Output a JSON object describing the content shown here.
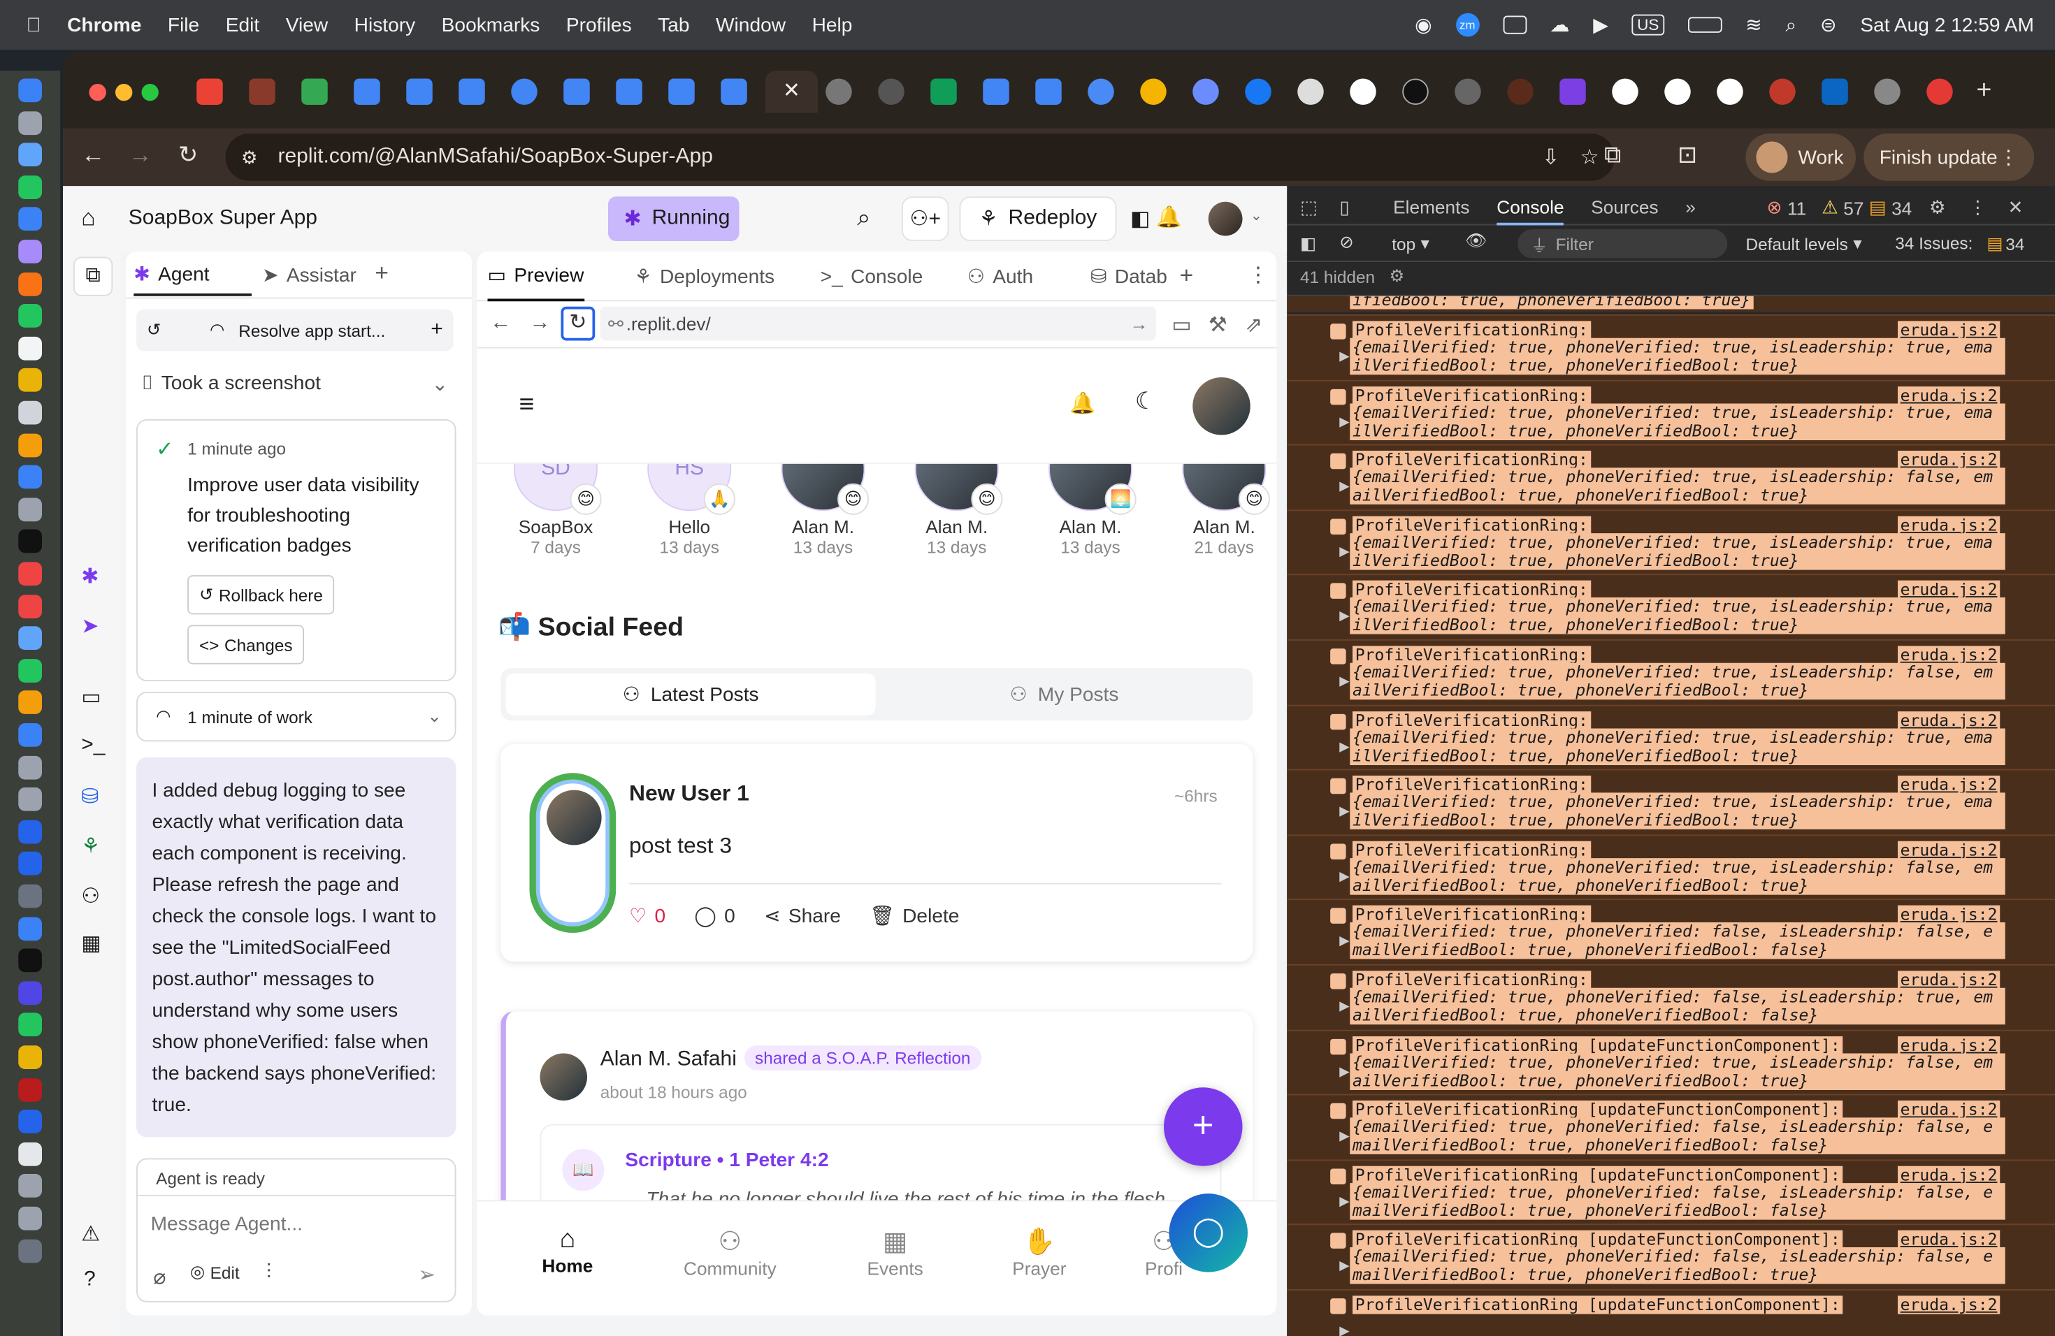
{
  "menubar": {
    "app": "Chrome",
    "items": [
      "File",
      "Edit",
      "View",
      "History",
      "Bookmarks",
      "Profiles",
      "Tab",
      "Window",
      "Help"
    ],
    "keyboard": "US",
    "datetime": "Sat Aug 2  12:59 AM"
  },
  "browser": {
    "url": "replit.com/@AlanMSafahi/SoapBox-Super-App",
    "profile": "Work",
    "finish_update": "Finish update"
  },
  "replit": {
    "app_title": "SoapBox Super App",
    "status": "Running",
    "redeploy": "Redeploy",
    "agent_tabs": [
      "Agent",
      "Assistar"
    ],
    "thread_title": "Resolve app start...",
    "screenshot_label": "Took a screenshot",
    "checkpoint": {
      "time": "1 minute ago",
      "message": "Improve user data visibility for troubleshooting verification badges",
      "rollback": "Rollback here",
      "changes": "Changes"
    },
    "work": "1 minute of work",
    "agent_message": "I added debug logging to see exactly what verification data each component is receiving. Please refresh the page and check the console logs. I want to see the \"LimitedSocialFeed post.author\" messages to understand why some users show phoneVerified: false when the backend says phoneVerified: true.",
    "agent_status": "Agent is ready",
    "message_placeholder": "Message Agent...",
    "edit_label": "Edit",
    "preview_tabs": [
      "Preview",
      "Deployments",
      "Console",
      "Auth",
      "Datab"
    ],
    "preview_url": ".replit.dev/"
  },
  "app": {
    "stories": [
      {
        "initials": "SD",
        "name": "SoapBox",
        "days": "7 days",
        "badge": "😊"
      },
      {
        "initials": "HS",
        "name": "Hello",
        "days": "13 days",
        "badge": "🙏"
      },
      {
        "initials": "",
        "name": "Alan M.",
        "days": "13 days",
        "badge": "😊"
      },
      {
        "initials": "",
        "name": "Alan M.",
        "days": "13 days",
        "badge": "😊"
      },
      {
        "initials": "",
        "name": "Alan M.",
        "days": "13 days",
        "badge": "🌅"
      },
      {
        "initials": "",
        "name": "Alan M.",
        "days": "21 days",
        "badge": "😊"
      }
    ],
    "feed_title": "📬 Social Feed",
    "feed_tabs": [
      "Latest Posts",
      "My Posts"
    ],
    "post": {
      "author": "New User 1",
      "time": "~6hrs",
      "text": "post test 3",
      "likes": "0",
      "comments": "0",
      "share": "Share",
      "delete": "Delete"
    },
    "reflection": {
      "author": "Alan M. Safahi",
      "tag": "shared a S.O.A.P. Reflection",
      "time": "about 18 hours ago",
      "scripture": "Scripture • 1 Peter 4:2",
      "verse": "That he no longer should live the rest of his time in the flesh"
    },
    "nav": [
      "Home",
      "Community",
      "Events",
      "Prayer",
      "Profi"
    ]
  },
  "devtools": {
    "tabs": [
      "Elements",
      "Console",
      "Sources"
    ],
    "errors": "11",
    "warnings": "57",
    "issues_count": "34",
    "context": "top",
    "filter_placeholder": "Filter",
    "levels": "Default levels",
    "issues_label": "34 Issues:",
    "issues_badge": "34",
    "hidden": "41 hidden",
    "first_line": "ifiedBool: true, phoneVerifiedBool: true}",
    "logs": [
      {
        "head": "ProfileVerificationRing:",
        "body": "{emailVerified: true, phoneVerified: true, isLeadership: true, emailVerifiedBool: true, phoneVerifiedBool: true}"
      },
      {
        "head": "ProfileVerificationRing:",
        "body": "{emailVerified: true, phoneVerified: true, isLeadership: true, emailVerifiedBool: true, phoneVerifiedBool: true}"
      },
      {
        "head": "ProfileVerificationRing:",
        "body": "{emailVerified: true, phoneVerified: true, isLeadership: false, emailVerifiedBool: true, phoneVerifiedBool: true}"
      },
      {
        "head": "ProfileVerificationRing:",
        "body": "{emailVerified: true, phoneVerified: true, isLeadership: true, emailVerifiedBool: true, phoneVerifiedBool: true}"
      },
      {
        "head": "ProfileVerificationRing:",
        "body": "{emailVerified: true, phoneVerified: true, isLeadership: true, emailVerifiedBool: true, phoneVerifiedBool: true}"
      },
      {
        "head": "ProfileVerificationRing:",
        "body": "{emailVerified: true, phoneVerified: true, isLeadership: false, emailVerifiedBool: true, phoneVerifiedBool: true}"
      },
      {
        "head": "ProfileVerificationRing:",
        "body": "{emailVerified: true, phoneVerified: true, isLeadership: true, emailVerifiedBool: true, phoneVerifiedBool: true}"
      },
      {
        "head": "ProfileVerificationRing:",
        "body": "{emailVerified: true, phoneVerified: true, isLeadership: true, emailVerifiedBool: true, phoneVerifiedBool: true}"
      },
      {
        "head": "ProfileVerificationRing:",
        "body": "{emailVerified: true, phoneVerified: true, isLeadership: false, emailVerifiedBool: true, phoneVerifiedBool: true}"
      },
      {
        "head": "ProfileVerificationRing:",
        "body": "{emailVerified: true, phoneVerified: false, isLeadership: false, emailVerifiedBool: true, phoneVerifiedBool: false}"
      },
      {
        "head": "ProfileVerificationRing:",
        "body": "{emailVerified: true, phoneVerified: false, isLeadership: true, emailVerifiedBool: true, phoneVerifiedBool: false}"
      },
      {
        "head": "ProfileVerificationRing [updateFunctionComponent]:",
        "body": "{emailVerified: true, phoneVerified: true, isLeadership: false, emailVerifiedBool: true, phoneVerifiedBool: true}"
      },
      {
        "head": "ProfileVerificationRing [updateFunctionComponent]:",
        "body": "{emailVerified: true, phoneVerified: false, isLeadership: false, emailVerifiedBool: true, phoneVerifiedBool: false}"
      },
      {
        "head": "ProfileVerificationRing [updateFunctionComponent]:",
        "body": "{emailVerified: true, phoneVerified: false, isLeadership: false, emailVerifiedBool: true, phoneVerifiedBool: false}"
      },
      {
        "head": "ProfileVerificationRing [updateFunctionComponent]:",
        "body": "{emailVerified: true, phoneVerified: false, isLeadership: false, emailVerifiedBool: true, phoneVerifiedBool: true}"
      },
      {
        "head": "ProfileVerificationRing [updateFunctionComponent]:",
        "body": ""
      }
    ],
    "source": "eruda.js:2"
  },
  "colors": {
    "accent": "#7c3aed",
    "running": "#c4b5fd",
    "log_bg": "#f5c09a",
    "log_row": "#4a2e1c"
  }
}
